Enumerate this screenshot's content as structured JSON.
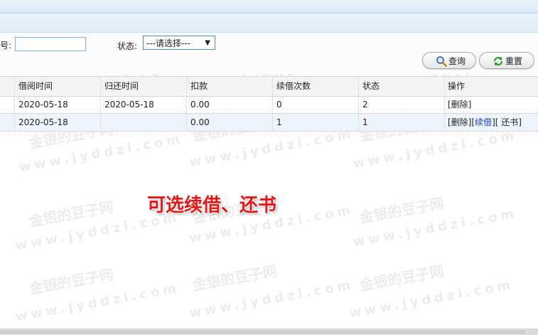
{
  "search": {
    "field_label": "号:",
    "status_label": "状态:",
    "status_selected": "---请选择---",
    "query_button": "查询",
    "reset_button": "重置"
  },
  "table": {
    "headers": [
      "借阅时间",
      "归还时间",
      "扣款",
      "续借次数",
      "状态",
      "操作"
    ],
    "rows": [
      {
        "borrow_time": "2020-05-18",
        "return_time": "2020-05-18",
        "deduction": "0.00",
        "renew_count": "0",
        "status": "2",
        "actions": [
          "[删除]"
        ]
      },
      {
        "borrow_time": "2020-05-18",
        "return_time": "",
        "deduction": "0.00",
        "renew_count": "1",
        "status": "1",
        "actions": [
          "[删除][",
          "续借",
          "][ 还书]"
        ]
      }
    ]
  },
  "annotation": "可选续借、还书",
  "watermark": {
    "brand": "金银的豆子网",
    "url": "www.jyddzi.com"
  },
  "colors": {
    "annotation": "#e01818",
    "link": "#1a3fb8",
    "selected_row": "#eef4fb"
  }
}
